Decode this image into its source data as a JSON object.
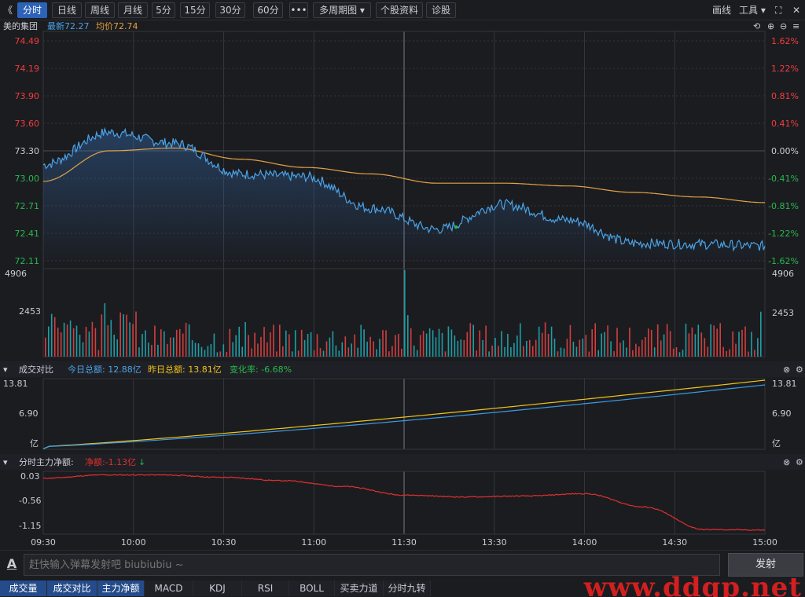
{
  "toolbar": {
    "back": "《",
    "buttons": [
      "分时",
      "日线",
      "周线",
      "月线",
      "5分",
      "15分",
      "30分",
      "60分",
      "•••"
    ],
    "active_index": 0,
    "multi_period": "多周期图 ▾",
    "stock_info": "个股资料",
    "diagnose": "诊股",
    "draw": "画线",
    "tools": "工具 ▾",
    "expand": "⛶",
    "close": "✕"
  },
  "header": {
    "name": "美的集团",
    "latest_label": "最新72.27",
    "avg_label": "均价72.74"
  },
  "colors": {
    "up": "#f23d3d",
    "down": "#27b84d",
    "price_line": "#4aa3e8",
    "avg_line": "#e5a244",
    "yesterday_line": "#f0c419",
    "today_line": "#3a9ae8",
    "netflow_line": "#e0302e",
    "vol_up": "#d13f3f",
    "vol_down": "#1e9ea5"
  },
  "price_axis": {
    "left": [
      "74.49",
      "74.19",
      "73.90",
      "73.60",
      "73.30",
      "73.00",
      "72.71",
      "72.41",
      "72.11"
    ],
    "right": [
      "1.62%",
      "1.22%",
      "0.81%",
      "0.41%",
      "0.00%",
      "-0.41%",
      "-0.81%",
      "-1.22%",
      "-1.62%"
    ],
    "min": 72.11,
    "max": 74.49,
    "prev_close": 73.3
  },
  "volume_axis": {
    "top": "4906",
    "mid": "2453",
    "max": 4906
  },
  "turnover_panel": {
    "title": "成交对比",
    "today": "今日总额: 12.88亿",
    "yesterday": "昨日总额: 13.81亿",
    "change": "变化率: -6.68%",
    "axis": [
      "13.81",
      "6.90",
      "亿"
    ],
    "max": 13.81
  },
  "netflow_panel": {
    "title": "分时主力净额:",
    "net": "净额:-1.13亿",
    "axis": [
      "0.03",
      "-0.56",
      "-1.15"
    ],
    "min": -1.15,
    "max": 0.03
  },
  "time_axis": [
    "09:30",
    "10:00",
    "10:30",
    "11:00",
    "11:30",
    "13:30",
    "14:00",
    "14:30",
    "15:00"
  ],
  "danmaku": {
    "placeholder": "赶快输入弹幕发射吧 biubiubiu ~",
    "send": "发射"
  },
  "bottom_tabs": [
    "成交量",
    "成交对比",
    "主力净额",
    "MACD",
    "KDJ",
    "RSI",
    "BOLL",
    "买卖力道",
    "分时九转"
  ],
  "bottom_tabs_active": [
    0,
    1,
    2
  ],
  "watermark": "www.ddgp.net",
  "chart_data": {
    "type": "line",
    "x": [
      "09:30",
      "10:00",
      "10:30",
      "11:00",
      "11:30",
      "13:30",
      "14:00",
      "14:30",
      "15:00"
    ],
    "series": [
      {
        "values": [
          73.15,
          73.5,
          73.38,
          73.05,
          73.02,
          72.68,
          72.45,
          72.72,
          72.55,
          72.3,
          72.29,
          72.27
        ]
      },
      {
        "values": [
          72.97,
          73.3,
          73.33,
          73.21,
          73.12,
          73.05,
          72.95,
          72.95,
          72.92,
          72.85,
          72.8,
          72.74
        ]
      }
    ],
    "ylim": [
      72.11,
      74.49
    ]
  }
}
